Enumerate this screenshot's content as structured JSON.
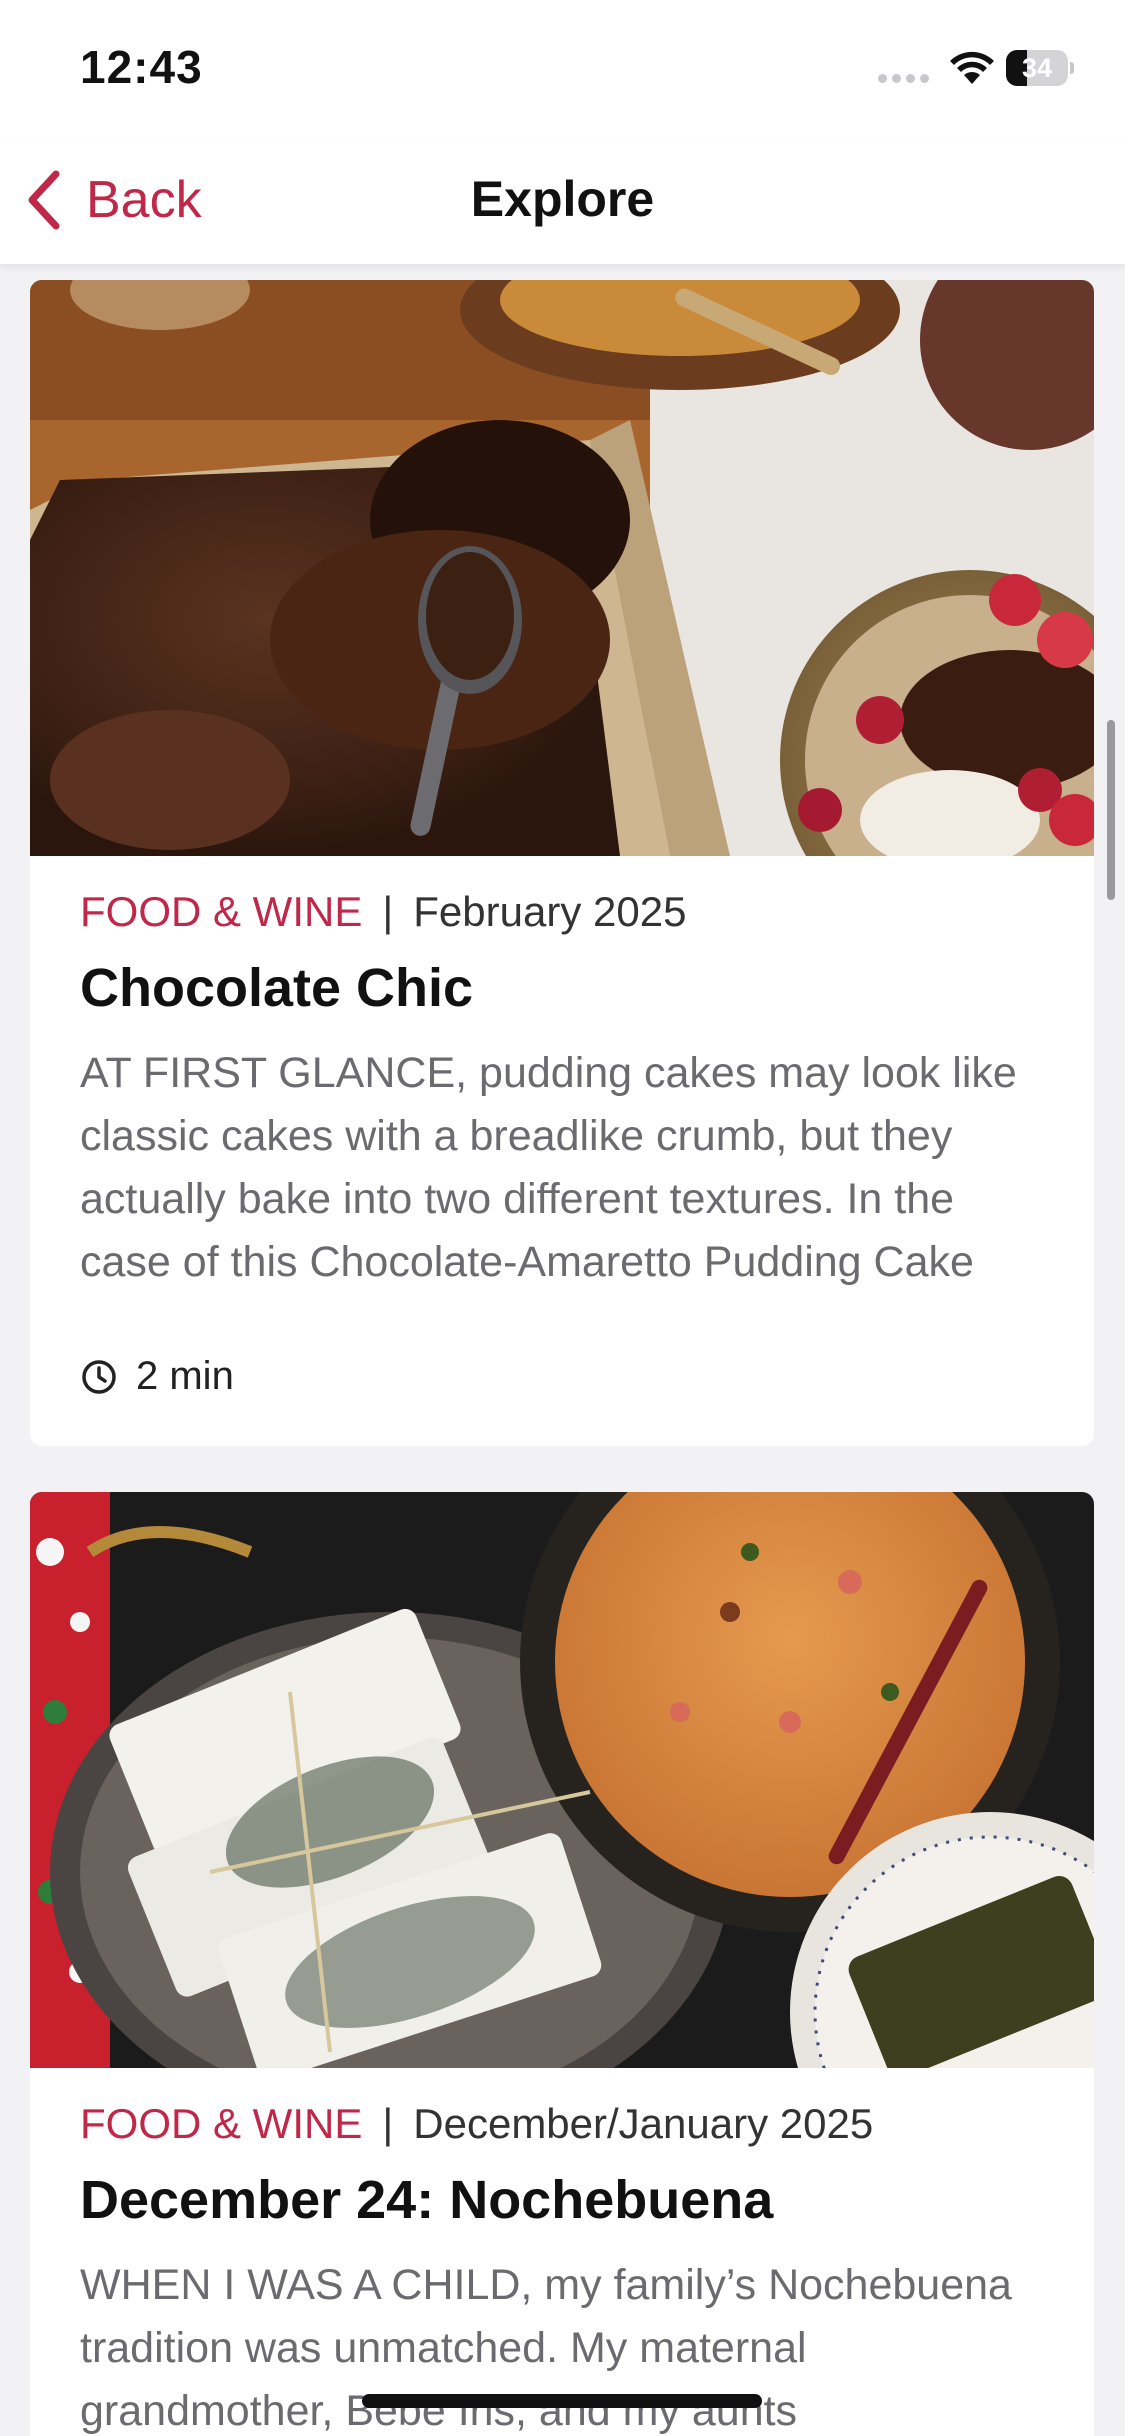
{
  "status_bar": {
    "time": "12:43",
    "battery_level": "34"
  },
  "nav": {
    "back_label": "Back",
    "title": "Explore"
  },
  "theme": {
    "accent": "#c0284a"
  },
  "articles": [
    {
      "publisher": "FOOD & WINE",
      "separator": "|",
      "issue": "February 2025",
      "title": "Chocolate Chic",
      "excerpt": "AT FIRST GLANCE, pudding cakes may look like classic cakes with a breadlike crumb, but they actually bake into two different textures. In the case of this Chocolate-Amaretto Pudding Cake",
      "read_time": "2 min",
      "image_icon": "chocolate-pudding-cake-photo"
    },
    {
      "publisher": "FOOD & WINE",
      "separator": "|",
      "issue": "December/January 2025",
      "title": "December 24: Nochebuena",
      "excerpt": "WHEN I WAS A CHILD, my family’s Nochebuena tradition was unmatched. My maternal grandmother, Bebe Iris, and my aunts",
      "image_icon": "tamales-and-rice-photo"
    }
  ]
}
